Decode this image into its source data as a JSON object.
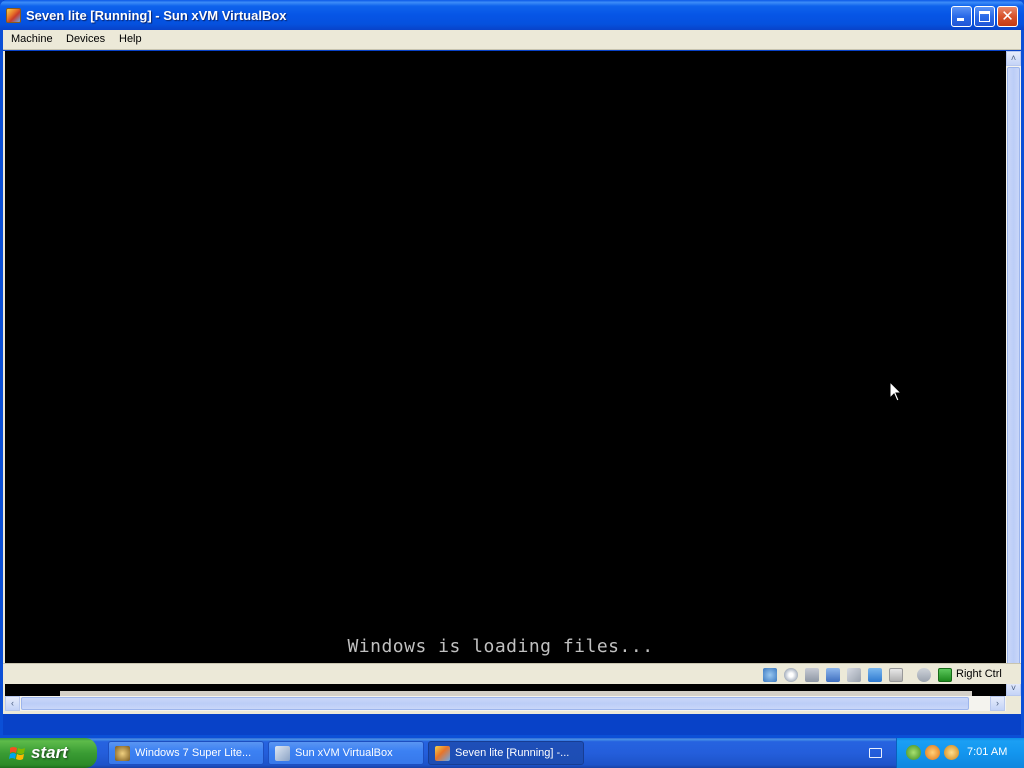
{
  "window": {
    "title": "Seven lite [Running] - Sun xVM VirtualBox",
    "minimize_label": "",
    "maximize_label": "",
    "close_label": "✕"
  },
  "menu": {
    "items": [
      {
        "label": "Machine"
      },
      {
        "label": "Devices"
      },
      {
        "label": "Help"
      }
    ]
  },
  "vm_screen": {
    "loading_text": "Windows is loading files..."
  },
  "scrollbars": {
    "left_arrow": "‹",
    "right_arrow": "›",
    "up_arrow": "˄",
    "down_arrow": "˅"
  },
  "statusbar": {
    "host_key_label": "Right Ctrl",
    "icons": [
      "hard-disk-icon",
      "cd-dvd-icon",
      "floppy-icon",
      "network-icon",
      "usb-icon",
      "shared-folders-icon",
      "vrdp-icon",
      "mouse-integration-icon",
      "host-key-icon"
    ]
  },
  "taskbar": {
    "start_label": "start",
    "tasks": [
      {
        "label": "Windows 7 Super Lite...",
        "icon": "browser-icon"
      },
      {
        "label": "Sun xVM VirtualBox",
        "icon": "virtualbox-icon"
      },
      {
        "label": "Seven lite [Running] -...",
        "icon": "vm-window-icon",
        "active": true
      }
    ],
    "clock": "7:01 AM"
  },
  "colors": {
    "title_bar": "#0655e6",
    "taskbar": "#245edb",
    "start_button": "#3a9c34",
    "screen": "#000000",
    "loading_text": "#c0c0c0"
  }
}
